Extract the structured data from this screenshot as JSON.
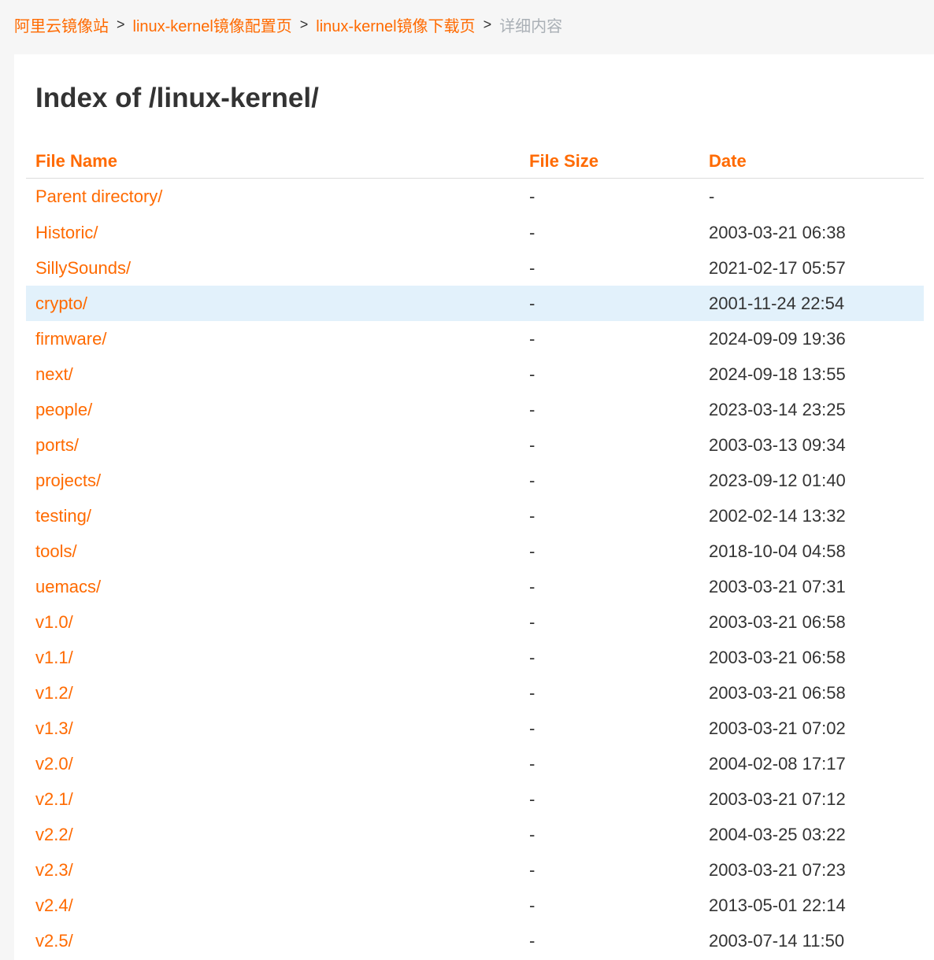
{
  "breadcrumb": {
    "items": [
      {
        "label": "阿里云镜像站"
      },
      {
        "label": "linux-kernel镜像配置页"
      },
      {
        "label": "linux-kernel镜像下载页"
      }
    ],
    "separator": ">",
    "current": "详细内容"
  },
  "page": {
    "title": "Index of /linux-kernel/"
  },
  "table": {
    "headers": {
      "name": "File Name",
      "size": "File Size",
      "date": "Date"
    },
    "rows": [
      {
        "name": "Parent directory/",
        "size": "-",
        "date": "-"
      },
      {
        "name": "Historic/",
        "size": "-",
        "date": "2003-03-21 06:38"
      },
      {
        "name": "SillySounds/",
        "size": "-",
        "date": "2021-02-17 05:57"
      },
      {
        "name": "crypto/",
        "size": "-",
        "date": "2001-11-24 22:54",
        "highlighted": true
      },
      {
        "name": "firmware/",
        "size": "-",
        "date": "2024-09-09 19:36"
      },
      {
        "name": "next/",
        "size": "-",
        "date": "2024-09-18 13:55"
      },
      {
        "name": "people/",
        "size": "-",
        "date": "2023-03-14 23:25"
      },
      {
        "name": "ports/",
        "size": "-",
        "date": "2003-03-13 09:34"
      },
      {
        "name": "projects/",
        "size": "-",
        "date": "2023-09-12 01:40"
      },
      {
        "name": "testing/",
        "size": "-",
        "date": "2002-02-14 13:32"
      },
      {
        "name": "tools/",
        "size": "-",
        "date": "2018-10-04 04:58"
      },
      {
        "name": "uemacs/",
        "size": "-",
        "date": "2003-03-21 07:31"
      },
      {
        "name": "v1.0/",
        "size": "-",
        "date": "2003-03-21 06:58"
      },
      {
        "name": "v1.1/",
        "size": "-",
        "date": "2003-03-21 06:58"
      },
      {
        "name": "v1.2/",
        "size": "-",
        "date": "2003-03-21 06:58"
      },
      {
        "name": "v1.3/",
        "size": "-",
        "date": "2003-03-21 07:02"
      },
      {
        "name": "v2.0/",
        "size": "-",
        "date": "2004-02-08 17:17"
      },
      {
        "name": "v2.1/",
        "size": "-",
        "date": "2003-03-21 07:12"
      },
      {
        "name": "v2.2/",
        "size": "-",
        "date": "2004-03-25 03:22"
      },
      {
        "name": "v2.3/",
        "size": "-",
        "date": "2003-03-21 07:23"
      },
      {
        "name": "v2.4/",
        "size": "-",
        "date": "2013-05-01 22:14"
      },
      {
        "name": "v2.5/",
        "size": "-",
        "date": "2003-07-14 11:50"
      }
    ]
  },
  "colors": {
    "accent": "#ff6a00",
    "text": "#333333",
    "muted": "#aab0b6",
    "highlight_row": "#e2f1fb",
    "page_bg": "#f6f6f6"
  }
}
